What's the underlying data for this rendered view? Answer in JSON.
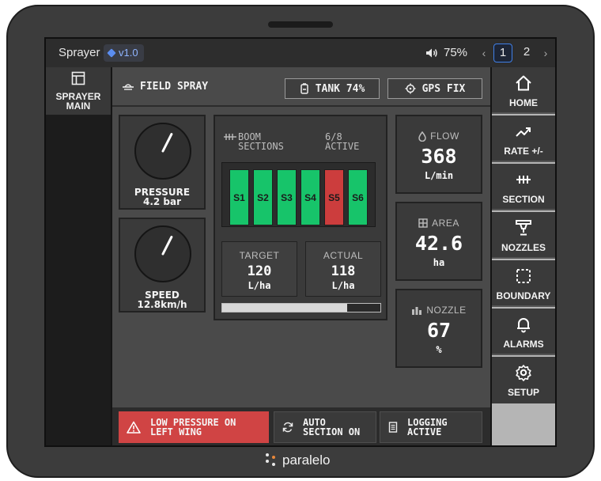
{
  "device": {
    "brand": "paralelo"
  },
  "topbar": {
    "app_title": "Sprayer",
    "version": "v1.0",
    "volume": "75%",
    "pages": [
      "1",
      "2"
    ],
    "active_page": "1"
  },
  "leftnav": {
    "items": [
      {
        "label_line1": "SPRAYER",
        "label_line2": "MAIN",
        "icon": "layout-icon"
      }
    ]
  },
  "header": {
    "title": "FIELD SPRAY",
    "tank_label": "TANK 74%",
    "gps_label": "GPS FIX"
  },
  "pressure": {
    "label": "PRESSURE",
    "value": "4.2 bar",
    "gauge_fraction": 0.6
  },
  "speed": {
    "label": "SPEED",
    "value": "12.8km/h",
    "gauge_fraction": 0.6
  },
  "boom": {
    "title_line1": "BOOM",
    "title_line2": "SECTIONS",
    "count_line1": "6/8",
    "count_line2": "ACTIVE",
    "sections": [
      {
        "label": "S1",
        "state": "on"
      },
      {
        "label": "S2",
        "state": "on"
      },
      {
        "label": "S3",
        "state": "on"
      },
      {
        "label": "S4",
        "state": "on"
      },
      {
        "label": "S5",
        "state": "off"
      },
      {
        "label": "S6",
        "state": "on"
      }
    ],
    "target": {
      "label": "TARGET",
      "value": "120",
      "unit": "L/ha"
    },
    "actual": {
      "label": "ACTUAL",
      "value": "118",
      "unit": "L/ha"
    },
    "progress_percent": 79
  },
  "metrics": {
    "flow": {
      "label": "FLOW",
      "value": "368",
      "unit": "L/min"
    },
    "area": {
      "label": "AREA",
      "value": "42.6",
      "unit": "ha"
    },
    "nozzle": {
      "label": "NOZZLE",
      "value": "67",
      "unit": "%"
    }
  },
  "status": {
    "alert_line1": "LOW PRESSURE ON",
    "alert_line2": "LEFT WING",
    "auto_line1": "AUTO",
    "auto_line2": "SECTION ON",
    "log_line1": "LOGGING",
    "log_line2": "ACTIVE"
  },
  "rightnav": {
    "home": "HOME",
    "rate": "RATE +/-",
    "section": "SECTION",
    "nozzles": "NOZZLES",
    "boundary": "BOUNDARY",
    "alarms": "ALARMS",
    "setup": "SETUP"
  },
  "colors": {
    "section_on": "#17c46a",
    "section_off": "#cc3d3d",
    "alert": "#d04444",
    "accent": "#3f7fe6"
  }
}
